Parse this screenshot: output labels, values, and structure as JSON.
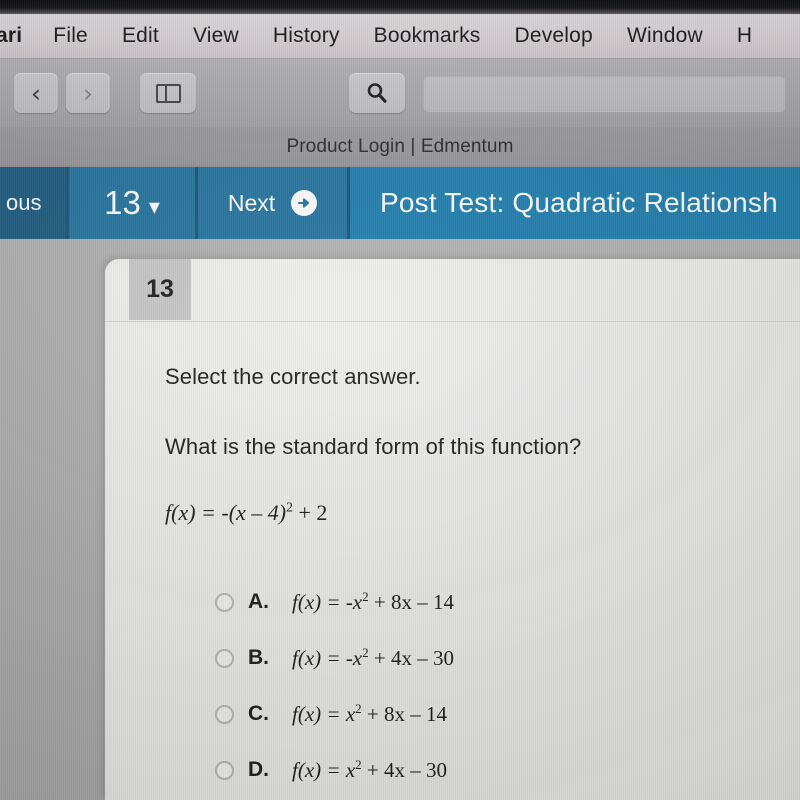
{
  "os": {
    "menu_bar": [
      {
        "label": "ari",
        "name": "menu-safari",
        "bold": true
      },
      {
        "label": "File",
        "name": "menu-file",
        "bold": false
      },
      {
        "label": "Edit",
        "name": "menu-edit",
        "bold": false
      },
      {
        "label": "View",
        "name": "menu-view",
        "bold": false
      },
      {
        "label": "History",
        "name": "menu-history",
        "bold": false
      },
      {
        "label": "Bookmarks",
        "name": "menu-bookmarks",
        "bold": false
      },
      {
        "label": "Develop",
        "name": "menu-develop",
        "bold": false
      },
      {
        "label": "Window",
        "name": "menu-window",
        "bold": false
      },
      {
        "label": "H",
        "name": "menu-help",
        "bold": false
      }
    ]
  },
  "browser": {
    "back_icon": "chevron-left-icon",
    "forward_icon": "chevron-right-icon",
    "sidebar_icon": "sidebar-toggle-icon",
    "search_icon": "search-icon",
    "address_value": "",
    "address_placeholder": "",
    "tab_title": "Product Login | Edmentum"
  },
  "assessment_nav": {
    "previous_label": "ous",
    "question_number": "13",
    "dropdown_caret": "⌄",
    "next_label": "Next",
    "next_icon": "arrow-right-circle-icon",
    "test_title": "Post Test: Quadratic Relationsh",
    "colors": {
      "previous_bg": "#1f5d82",
      "segment_bg": "#2674a0",
      "title_bg": "#1f7fae",
      "divider": "#1a5576",
      "text": "#ffffff"
    }
  },
  "question": {
    "number_badge": "13",
    "instruction": "Select the correct answer.",
    "prompt": "What is the standard form of this function?",
    "formula": {
      "lead": "f(x) = -(x – 4)",
      "exponent": "2",
      "tail": " + 2"
    },
    "options": [
      {
        "letter": "A.",
        "selected": false,
        "formula_lead": "f(x) = -x",
        "formula_exponent": "2",
        "formula_tail": " + 8x – 14",
        "text": "f(x) = -x2 + 8x – 14"
      },
      {
        "letter": "B.",
        "selected": false,
        "formula_lead": "f(x) = -x",
        "formula_exponent": "2",
        "formula_tail": " + 4x – 30",
        "text": "f(x) = -x2 + 4x – 30"
      },
      {
        "letter": "C.",
        "selected": false,
        "formula_lead": "f(x) = x",
        "formula_exponent": "2",
        "formula_tail": " + 8x – 14",
        "text": "f(x) = x2 + 8x – 14"
      },
      {
        "letter": "D.",
        "selected": false,
        "formula_lead": "f(x) = x",
        "formula_exponent": "2",
        "formula_tail": " + 4x – 30",
        "text": "f(x) = x2 + 4x – 30"
      }
    ]
  }
}
